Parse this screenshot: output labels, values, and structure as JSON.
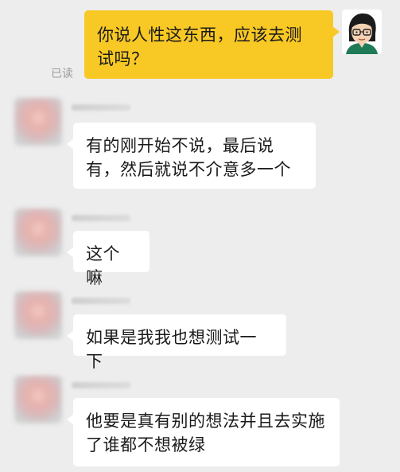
{
  "conversation": {
    "outgoing": {
      "text": "你说人性这东西，应该去测试吗？",
      "read_status": "已读"
    },
    "incoming": [
      {
        "text": "有的刚开始不说，最后说有，然后就说不介意多一个"
      },
      {
        "text": "这个嘛"
      },
      {
        "text": "如果是我我也想测试一下"
      },
      {
        "text": "他要是真有别的想法并且去实施了谁都不想被绿"
      }
    ]
  },
  "colors": {
    "background": "#ededed",
    "outgoing_bubble": "#f8c824",
    "incoming_bubble": "#ffffff",
    "read_status": "#9a9a9a"
  },
  "icons": {
    "self_avatar": "cartoon-woman-with-glasses-avatar",
    "other_avatar": "blurred-avatar"
  }
}
